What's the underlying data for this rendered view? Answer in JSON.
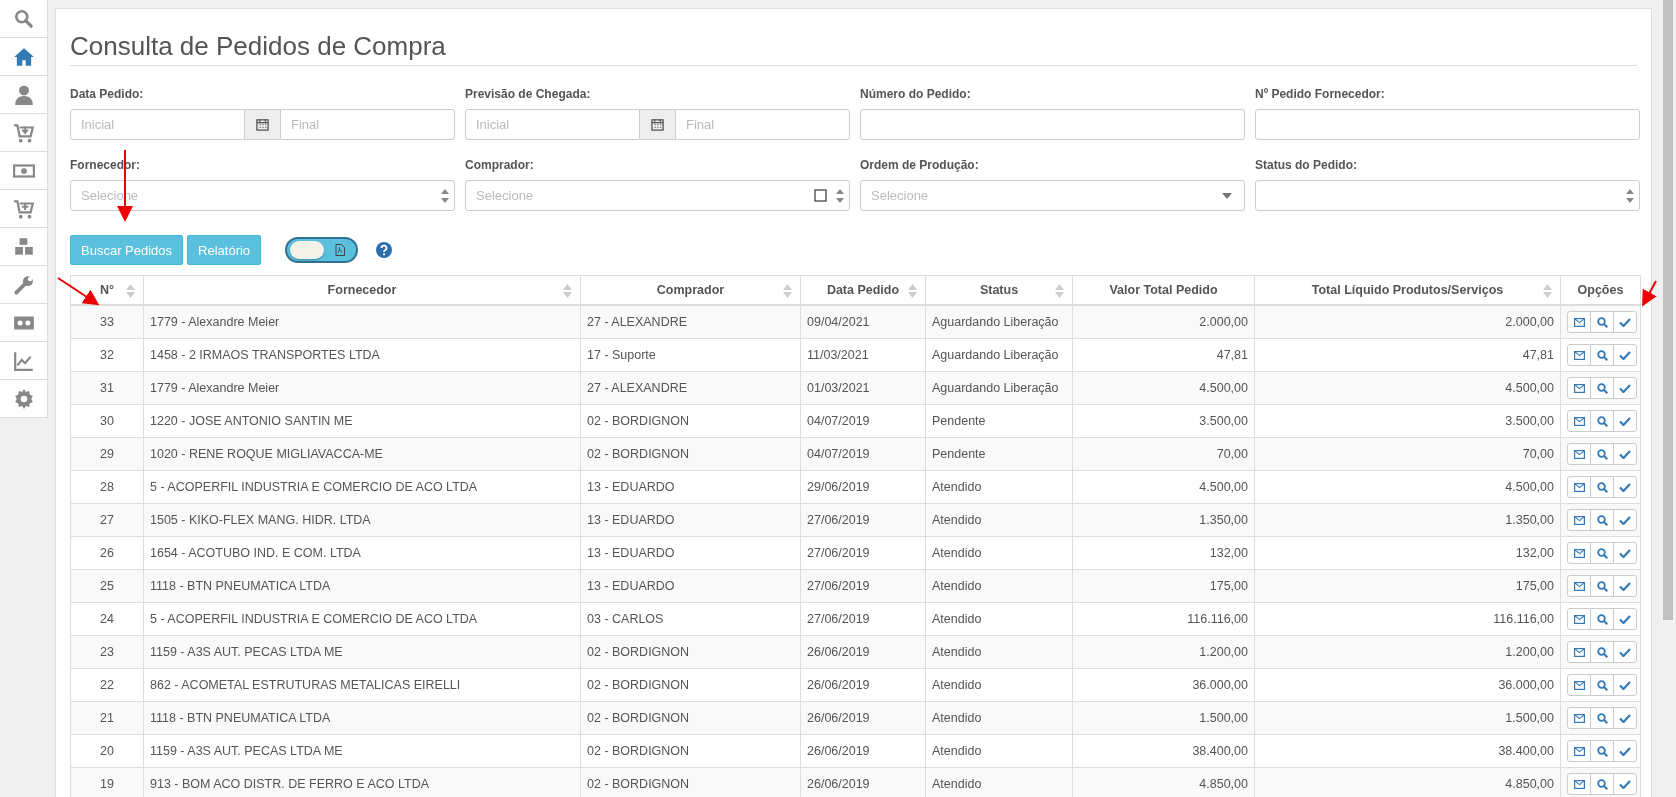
{
  "sidebar": {
    "items": [
      {
        "kind": "search",
        "selected": false
      },
      {
        "kind": "home",
        "selected": true
      },
      {
        "kind": "user",
        "selected": false
      },
      {
        "kind": "cart-down",
        "selected": false
      },
      {
        "kind": "money",
        "selected": false
      },
      {
        "kind": "cart-plus",
        "selected": false
      },
      {
        "kind": "cubes",
        "selected": false
      },
      {
        "kind": "wrench",
        "selected": false
      },
      {
        "kind": "tape",
        "selected": false
      },
      {
        "kind": "chart",
        "selected": false
      },
      {
        "kind": "gear",
        "selected": false
      }
    ]
  },
  "title": "Consulta de Pedidos de Compra",
  "filters": [
    {
      "kind": "date-range",
      "label": "Data Pedido:",
      "placeholder_start": "Inicial",
      "placeholder_end": "Final"
    },
    {
      "kind": "date-range",
      "label": "Previsão de Chegada:",
      "placeholder_start": "Inicial",
      "placeholder_end": "Final"
    },
    {
      "kind": "text",
      "label": "Número do Pedido:"
    },
    {
      "kind": "text",
      "label": "Nº Pedido Fornecedor:"
    },
    {
      "kind": "multiselect",
      "label": "Fornecedor:",
      "placeholder": "Selecione"
    },
    {
      "kind": "multiselect-check",
      "label": "Comprador:",
      "placeholder": "Selecione",
      "checked": false
    },
    {
      "kind": "dropdown",
      "label": "Ordem de Produção:",
      "placeholder": "Selecione"
    },
    {
      "kind": "multiselect",
      "label": "Status do Pedido:"
    }
  ],
  "buttons": [
    "Buscar Pedidos",
    "Relatório"
  ],
  "pdf_toggle": {
    "on": false
  },
  "table": {
    "columns": [
      {
        "label": "N°",
        "sortable": true
      },
      {
        "label": "Fornecedor",
        "sortable": true
      },
      {
        "label": "Comprador",
        "sortable": true
      },
      {
        "label": "Data Pedido",
        "sortable": true
      },
      {
        "label": "Status",
        "sortable": true
      },
      {
        "label": "Valor Total Pedido",
        "sortable": false
      },
      {
        "label": "Total Líquido Produtos/Serviços",
        "sortable": true
      },
      {
        "label": "Opções",
        "sortable": false
      }
    ],
    "rows": [
      [
        "33",
        "1779 - Alexandre Meier",
        "27 - ALEXANDRE",
        "09/04/2021",
        "Aguardando Liberação",
        "2.000,00",
        "2.000,00"
      ],
      [
        "32",
        "1458 - 2 IRMAOS TRANSPORTES LTDA",
        "17 - Suporte",
        "11/03/2021",
        "Aguardando Liberação",
        "47,81",
        "47,81"
      ],
      [
        "31",
        "1779 - Alexandre Meier",
        "27 - ALEXANDRE",
        "01/03/2021",
        "Aguardando Liberação",
        "4.500,00",
        "4.500,00"
      ],
      [
        "30",
        "1220 - JOSE ANTONIO SANTIN ME",
        "02 - BORDIGNON",
        "04/07/2019",
        "Pendente",
        "3.500,00",
        "3.500,00"
      ],
      [
        "29",
        "1020 - RENE ROQUE MIGLIAVACCA-ME",
        "02 - BORDIGNON",
        "04/07/2019",
        "Pendente",
        "70,00",
        "70,00"
      ],
      [
        "28",
        "5 - ACOPERFIL INDUSTRIA E COMERCIO DE ACO LTDA",
        "13 - EDUARDO",
        "29/06/2019",
        "Atendido",
        "4.500,00",
        "4.500,00"
      ],
      [
        "27",
        "1505 - KIKO-FLEX MANG. HIDR. LTDA",
        "13 - EDUARDO",
        "27/06/2019",
        "Atendido",
        "1.350,00",
        "1.350,00"
      ],
      [
        "26",
        "1654 - ACOTUBO IND. E COM. LTDA",
        "13 - EDUARDO",
        "27/06/2019",
        "Atendido",
        "132,00",
        "132,00"
      ],
      [
        "25",
        "1118 - BTN PNEUMATICA LTDA",
        "13 - EDUARDO",
        "27/06/2019",
        "Atendido",
        "175,00",
        "175,00"
      ],
      [
        "24",
        "5 - ACOPERFIL INDUSTRIA E COMERCIO DE ACO LTDA",
        "03 - CARLOS",
        "27/06/2019",
        "Atendido",
        "116.116,00",
        "116.116,00"
      ],
      [
        "23",
        "1159 - A3S AUT. PECAS LTDA ME",
        "02 - BORDIGNON",
        "26/06/2019",
        "Atendido",
        "1.200,00",
        "1.200,00"
      ],
      [
        "22",
        "862 - ACOMETAL ESTRUTURAS METALICAS EIRELLI",
        "02 - BORDIGNON",
        "26/06/2019",
        "Atendido",
        "36.000,00",
        "36.000,00"
      ],
      [
        "21",
        "1118 - BTN PNEUMATICA LTDA",
        "02 - BORDIGNON",
        "26/06/2019",
        "Atendido",
        "1.500,00",
        "1.500,00"
      ],
      [
        "20",
        "1159 - A3S AUT. PECAS LTDA ME",
        "02 - BORDIGNON",
        "26/06/2019",
        "Atendido",
        "38.400,00",
        "38.400,00"
      ],
      [
        "19",
        "913 - BOM ACO DISTR. DE FERRO E ACO LTDA",
        "02 - BORDIGNON",
        "26/06/2019",
        "Atendido",
        "4.850,00",
        "4.850,00"
      ]
    ]
  }
}
